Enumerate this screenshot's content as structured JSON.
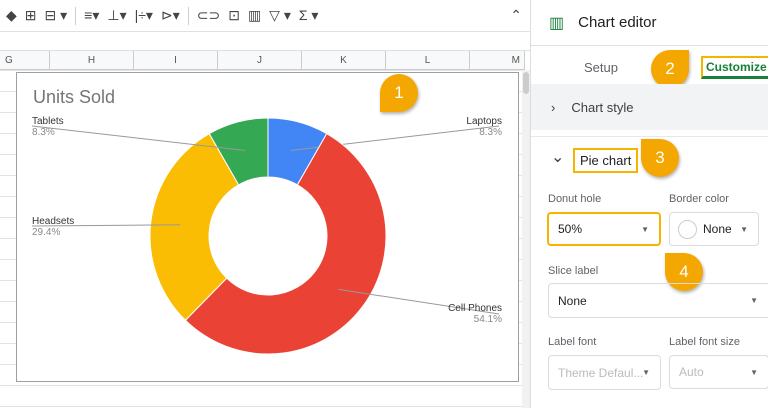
{
  "toolbar": {
    "icons": [
      "fill-color-icon",
      "borders-icon",
      "merge-cells-icon",
      "align-icon",
      "valign-icon",
      "text-wrap-icon",
      "text-rotate-icon",
      "link-icon",
      "comment-icon",
      "chart-icon",
      "filter-icon",
      "functions-icon",
      "collapse-icon"
    ]
  },
  "columns": [
    "G",
    "H",
    "I",
    "J",
    "K",
    "L",
    "M"
  ],
  "chart_data": {
    "type": "pie",
    "title": "Units Sold",
    "donut_hole": 0.5,
    "slices": [
      {
        "label": "Laptops",
        "value": 8.3,
        "pct": "8.3%",
        "color": "#4285f4"
      },
      {
        "label": "Cell Phones",
        "value": 54.1,
        "pct": "54.1%",
        "color": "#ea4335"
      },
      {
        "label": "Headsets",
        "value": 29.4,
        "pct": "29.4%",
        "color": "#fbbc04"
      },
      {
        "label": "Tablets",
        "value": 8.3,
        "pct": "8.3%",
        "color": "#34a853"
      }
    ]
  },
  "editor": {
    "title": "Chart editor",
    "tabs": {
      "setup": "Setup",
      "customize": "Customize"
    },
    "chart_style": "Chart style",
    "pie_chart": "Pie chart",
    "donut_hole_label": "Donut hole",
    "donut_hole_value": "50%",
    "border_color_label": "Border color",
    "border_color_value": "None",
    "slice_label_label": "Slice label",
    "slice_label_value": "None",
    "label_font_label": "Label font",
    "label_font_value": "Theme Defaul...",
    "label_font_size_label": "Label font size",
    "label_font_size_value": "Auto"
  },
  "callouts": [
    "1",
    "2",
    "3",
    "4"
  ],
  "accent": "#f4a700"
}
